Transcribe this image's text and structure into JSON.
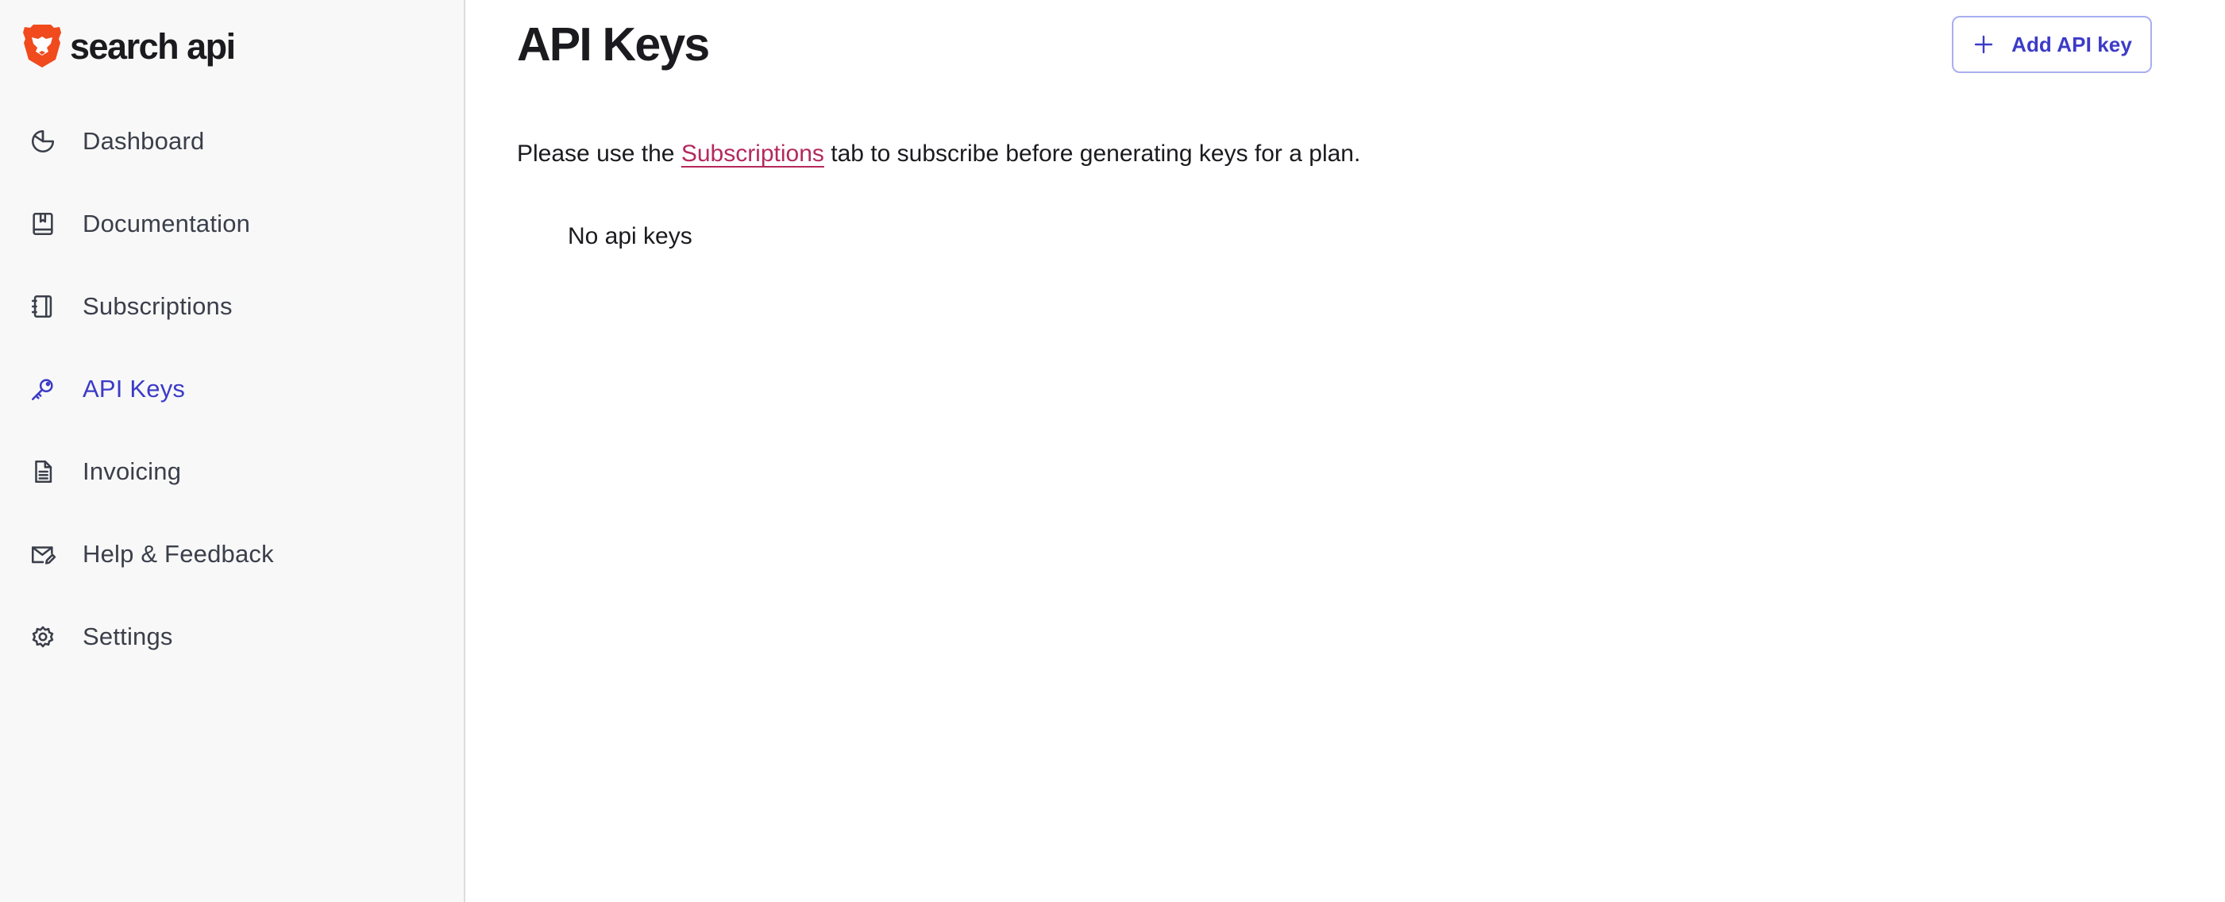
{
  "brand": {
    "name": "search api",
    "logo_icon": "brave-lion-icon",
    "logo_color": "#f04a1d"
  },
  "sidebar": {
    "items": [
      {
        "label": "Dashboard",
        "icon": "pie-chart-icon",
        "active": false
      },
      {
        "label": "Documentation",
        "icon": "book-icon",
        "active": false
      },
      {
        "label": "Subscriptions",
        "icon": "notebook-icon",
        "active": false
      },
      {
        "label": "API Keys",
        "icon": "key-icon",
        "active": true
      },
      {
        "label": "Invoicing",
        "icon": "document-icon",
        "active": false
      },
      {
        "label": "Help & Feedback",
        "icon": "mail-edit-icon",
        "active": false
      },
      {
        "label": "Settings",
        "icon": "gear-icon",
        "active": false
      }
    ]
  },
  "main": {
    "title": "API Keys",
    "add_button_label": "Add API key",
    "notice": {
      "before": "Please use the ",
      "link": "Subscriptions",
      "after": " tab to subscribe before generating keys for a plan."
    },
    "empty_message": "No api keys"
  },
  "colors": {
    "accent": "#3c3bc7",
    "link": "#b4295c",
    "sidebar_bg": "#f8f8f8"
  }
}
